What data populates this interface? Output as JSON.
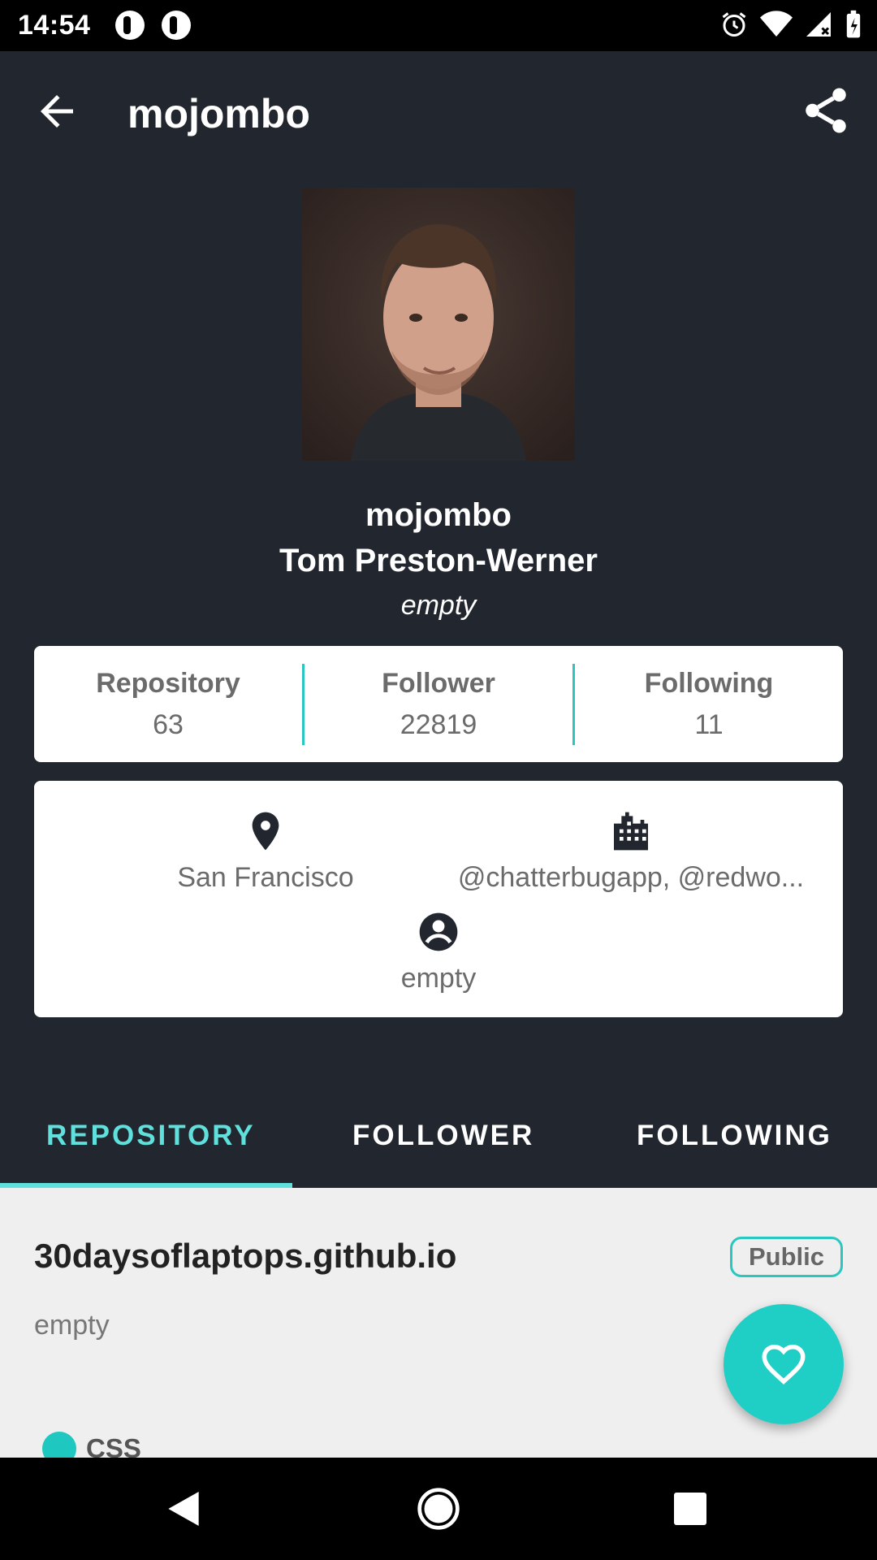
{
  "status_bar": {
    "time": "14:54"
  },
  "app_bar": {
    "title": "mojombo"
  },
  "profile": {
    "username": "mojombo",
    "full_name": "Tom Preston-Werner",
    "bio": "empty"
  },
  "stats": [
    {
      "label": "Repository",
      "value": "63"
    },
    {
      "label": "Follower",
      "value": "22819"
    },
    {
      "label": "Following",
      "value": "11"
    }
  ],
  "info": {
    "location": "San Francisco",
    "company": "@chatterbugapp, @redwo...",
    "blog": "empty"
  },
  "tabs": [
    {
      "label": "REPOSITORY",
      "active": true
    },
    {
      "label": "FOLLOWER",
      "active": false
    },
    {
      "label": "FOLLOWING",
      "active": false
    }
  ],
  "repositories": [
    {
      "name": "30daysoflaptops.github.io",
      "visibility": "Public",
      "description": "empty",
      "language": "CSS"
    }
  ],
  "icons": {
    "back": "arrow-back-icon",
    "share": "share-icon",
    "location": "location-pin-icon",
    "company": "building-icon",
    "blog": "account-circle-icon",
    "fab": "heart-icon"
  },
  "colors": {
    "background": "#22262e",
    "accent": "#29c7c0",
    "tab_active": "#5fe0dc",
    "list_background": "#efefef"
  }
}
